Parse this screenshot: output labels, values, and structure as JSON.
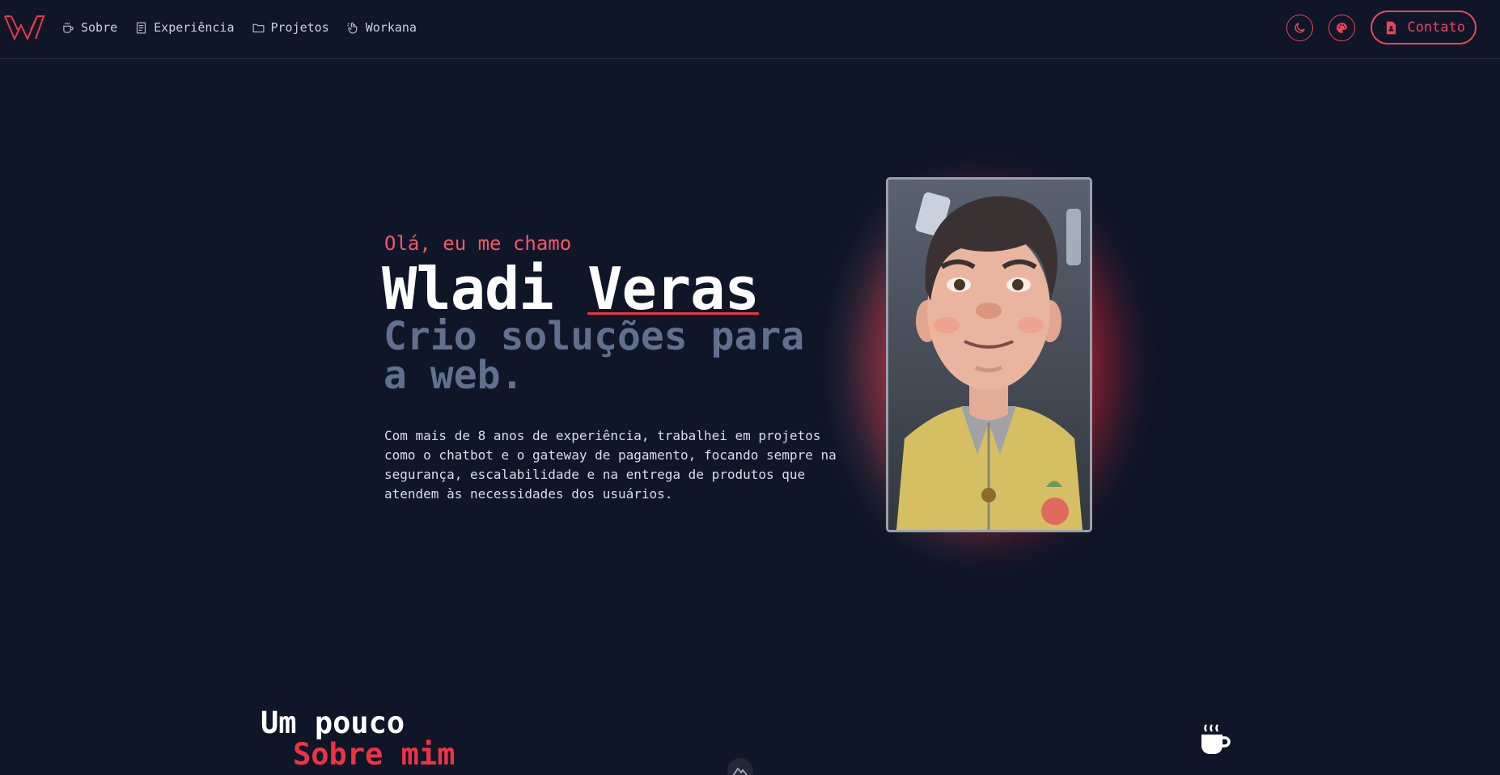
{
  "header": {
    "nav": [
      {
        "label": "Sobre",
        "icon": "coffee-icon"
      },
      {
        "label": "Experiência",
        "icon": "document-icon"
      },
      {
        "label": "Projetos",
        "icon": "folder-icon"
      },
      {
        "label": "Workana",
        "icon": "hand-pointer-icon"
      }
    ],
    "contact_label": "Contato"
  },
  "hero": {
    "greeting": "Olá, eu me chamo",
    "first_name": "Wladi",
    "last_name": "Veras",
    "tagline": "Crio soluções para a web.",
    "bio": "Com mais de 8 anos de experiência, trabalhei em projetos como o chatbot e o gateway de pagamento, focando sempre na segurança, escalabilidade e na entrega de produtos que atendem às necessidades dos usuários."
  },
  "about": {
    "line1": "Um pouco",
    "line2": "Sobre mim"
  },
  "colors": {
    "background": "#0f1628",
    "accent": "#ef4456",
    "muted_heading": "#61708c"
  }
}
